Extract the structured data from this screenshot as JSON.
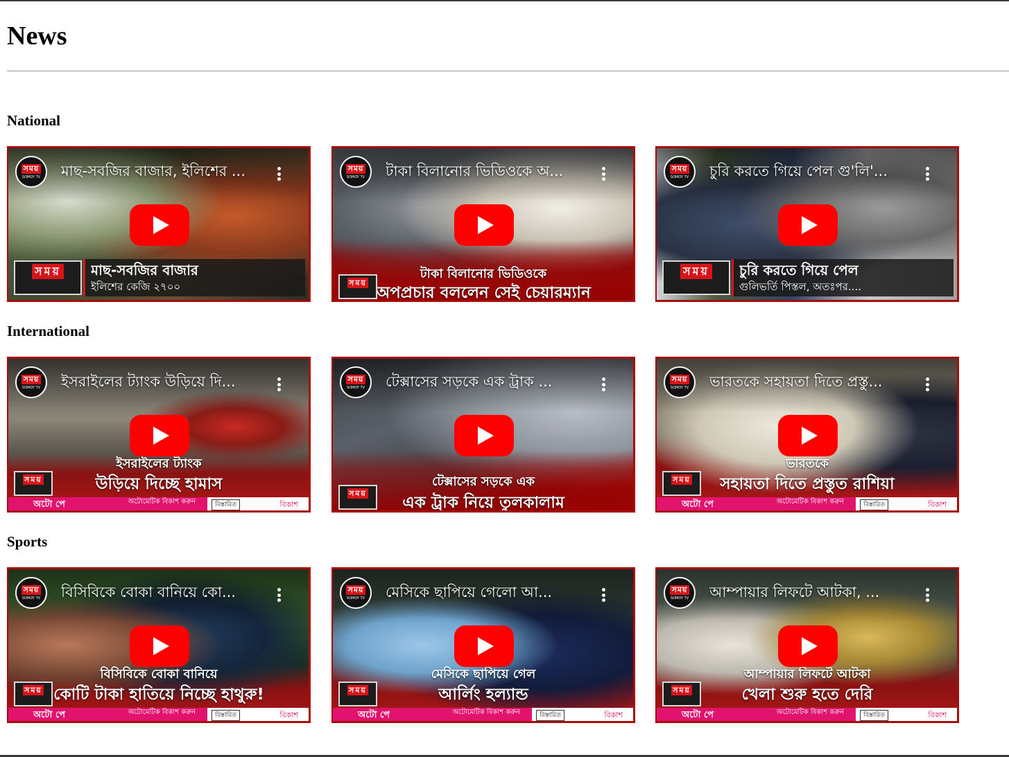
{
  "page": {
    "title": "News"
  },
  "sections": [
    {
      "heading": "National",
      "videos": [
        {
          "title": "মাছ-সবজির বাজার, ইলিশের ...",
          "caption_line1": "মাছ-সবজির বাজার",
          "caption_line2": "ইলিশের কেজি ২৭০০"
        },
        {
          "title": "টাকা বিলানোর ভিডিওকে অ...",
          "caption_line1": "টাকা বিলানোর ভিডিওকে",
          "caption_line2": "অপপ্রচার বললেন সেই চেয়ারম্যান"
        },
        {
          "title": "চুরি করতে গিয়ে পেল গু'লি'...",
          "caption_line1": "চুরি করতে গিয়ে পেল",
          "caption_line2": "গুলিভর্তি পিস্তল, অতঃপর...."
        }
      ]
    },
    {
      "heading": "International",
      "videos": [
        {
          "title": "ইসরাইলের ট্যাংক উড়িয়ে দি...",
          "caption_line1": "ইসরাইলের ট্যাংক",
          "caption_line2": "উড়িয়ে দিচ্ছে হামাস"
        },
        {
          "title": "টেক্সাসের সড়কে এক ট্রাক ...",
          "caption_line1": "টেক্সাসের সড়কে এক",
          "caption_line2": "এক ট্রাক নিয়ে তুলকালাম"
        },
        {
          "title": "ভারতকে সহায়তা দিতে প্রস্তু...",
          "caption_line1": "ভারতকে",
          "caption_line2": "সহায়তা দিতে প্রস্তুত রাশিয়া"
        }
      ]
    },
    {
      "heading": "Sports",
      "videos": [
        {
          "title": "বিসিবিকে বোকা বানিয়ে কো...",
          "caption_line1": "বিসিবিকে বোকা বানিয়ে",
          "caption_line2": "কোটি টাকা হাতিয়ে নিচ্ছে হাথুরু!"
        },
        {
          "title": "মেসিকে ছাপিয়ে গেলো আ...",
          "caption_line1": "মেসিকে ছাপিয়ে গেল",
          "caption_line2": "আর্লিং হল্যান্ড"
        },
        {
          "title": "আম্পায়ার লিফটে আটকা, ...",
          "caption_line1": "আম্পায়ার লিফটে আটকা",
          "caption_line2": "খেলা শুরু হতে দেরি"
        }
      ]
    }
  ],
  "channel": {
    "logo_text": "সময়",
    "logo_subtext": "SOMOY TV"
  },
  "ad": {
    "brand_text": "অটো পে",
    "tagline": "অটোমেটিক বিকাশ করুন",
    "details_label": "বিস্তারিত",
    "brand_name": "বিকাশ"
  },
  "icons": {
    "play": "play-icon",
    "menu": "more-vert-icon",
    "logo": "channel-logo-icon"
  },
  "colors": {
    "play_red": "#ff0000",
    "brand_red": "#d8141b",
    "ad_pink": "#e2136e"
  }
}
